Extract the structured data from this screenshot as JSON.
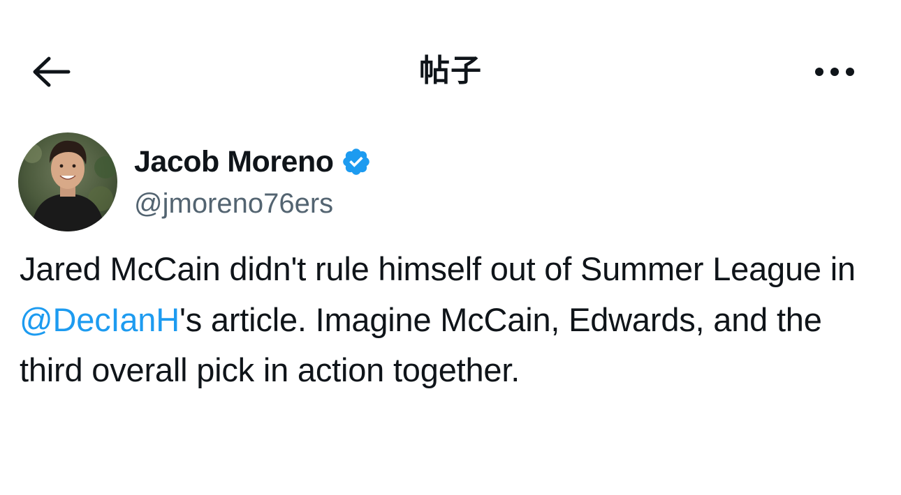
{
  "header": {
    "title": "帖子",
    "back_icon": "arrow-left-icon",
    "more_icon": "more-horizontal-icon"
  },
  "author": {
    "display_name": "Jacob Moreno",
    "handle": "@jmoreno76ers",
    "verified": true,
    "verified_color": "#1d9bf0",
    "avatar_icon": "avatar"
  },
  "tweet": {
    "text_before": "Jared McCain didn't rule himself out of Summer League in ",
    "mention": "@DecIanH",
    "text_after": "'s article. Imagine McCain, Edwards, and the third overall pick in action together.",
    "mention_color": "#1d9bf0"
  }
}
